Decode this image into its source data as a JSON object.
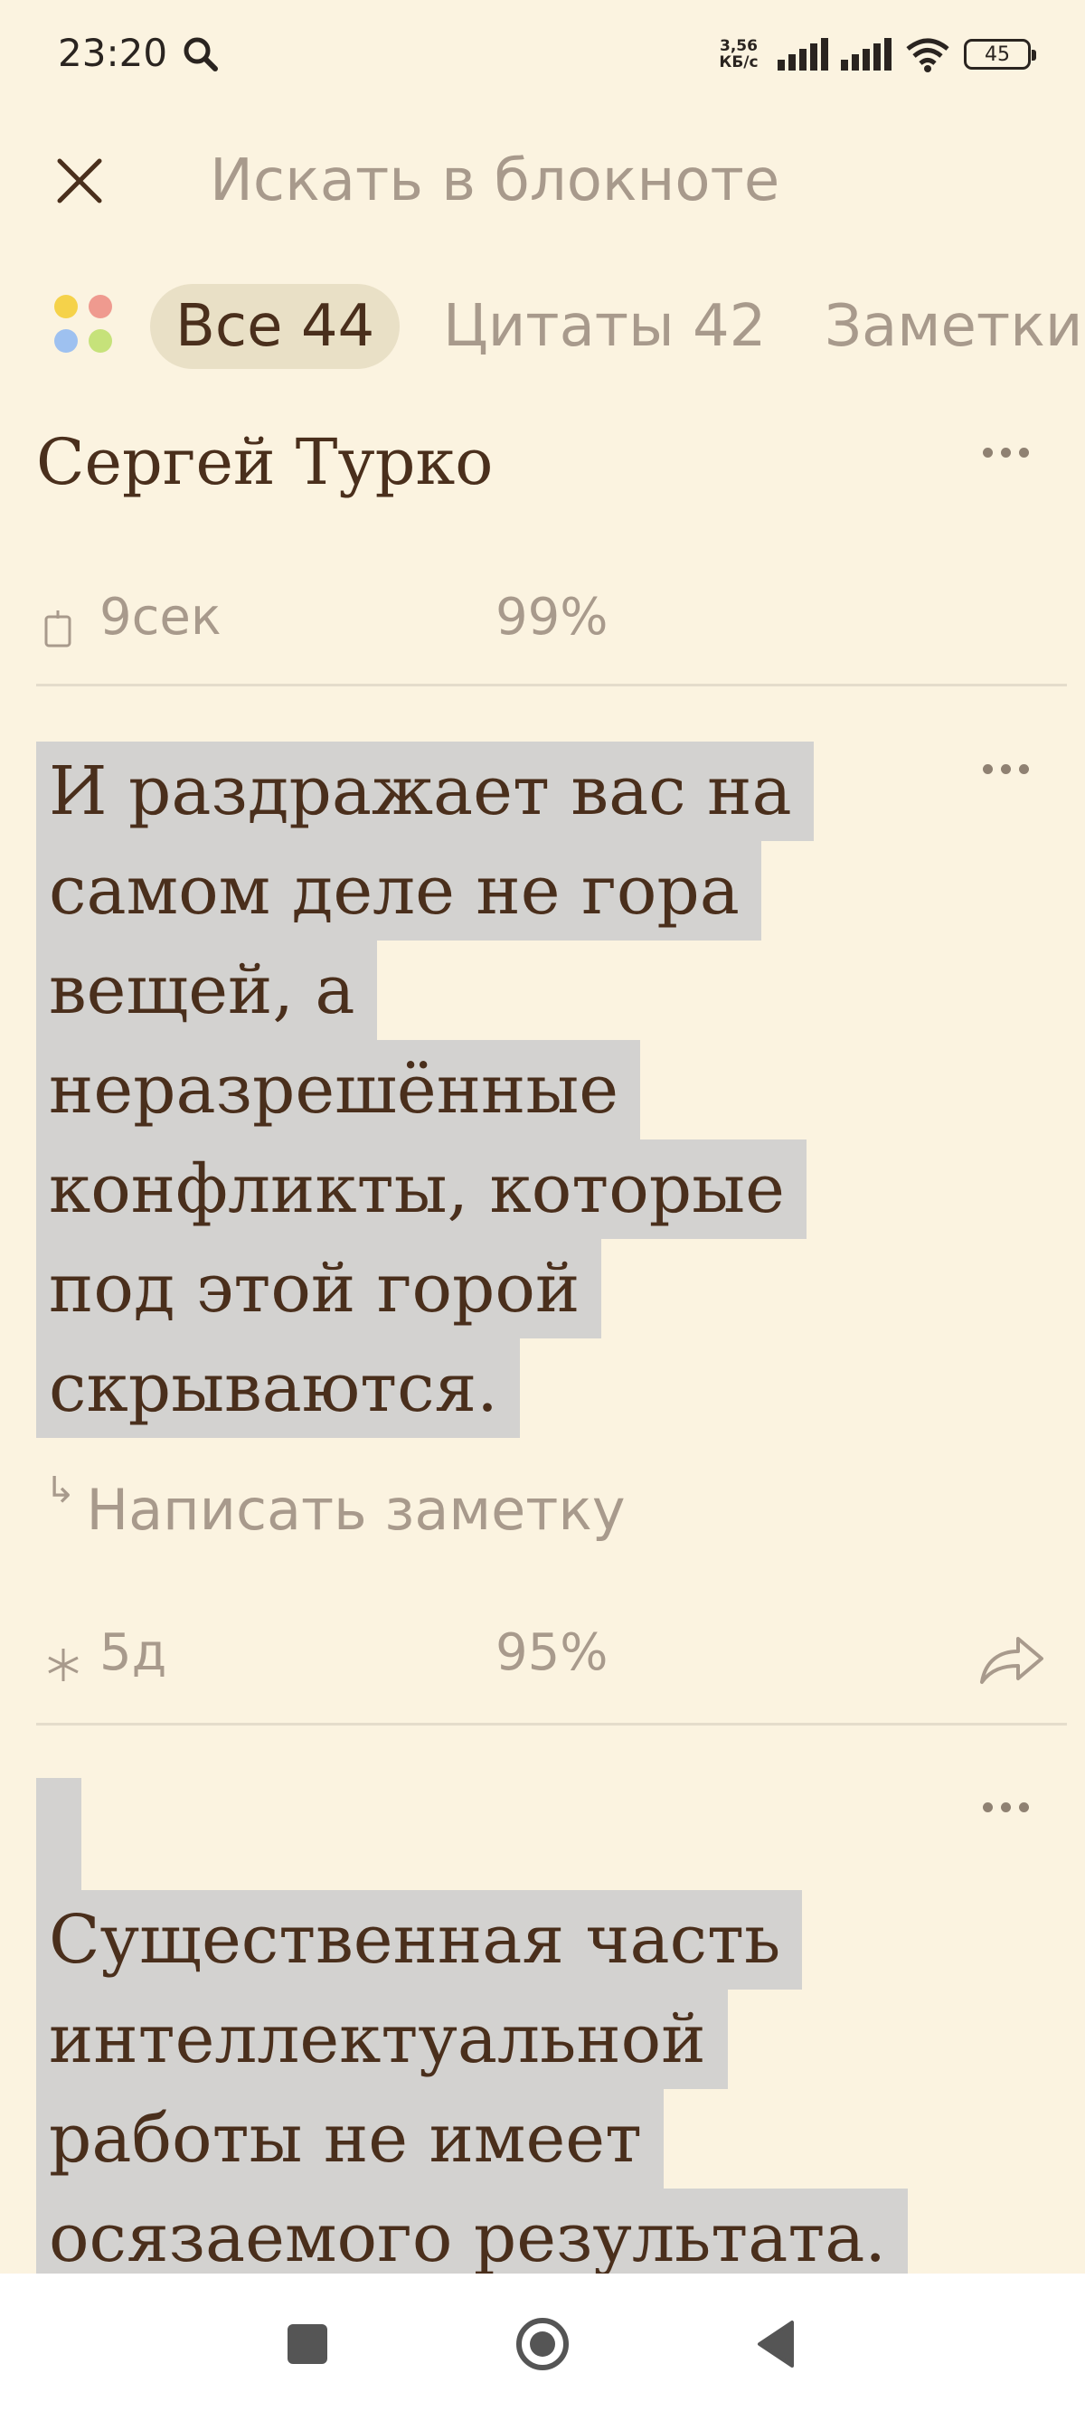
{
  "status_bar": {
    "time": "23:20",
    "net_speed_value": "3,56",
    "net_speed_unit": "КБ/с",
    "battery": "45",
    "icons": [
      "search-icon",
      "signal-icon",
      "signal-icon",
      "wifi-icon",
      "battery-icon"
    ]
  },
  "search": {
    "placeholder": "Искать в блокноте"
  },
  "filters": {
    "items": [
      {
        "label": "Все 44",
        "active": true
      },
      {
        "label": "Цитаты 42",
        "active": false
      },
      {
        "label": "Заметки",
        "active": false
      }
    ],
    "dot_colors": [
      "#f5d24a",
      "#ef9a8f",
      "#9ec1f0",
      "#c6e27a"
    ]
  },
  "book": {
    "title": "Сергей Турко",
    "read_time": "9сек",
    "progress": "99%"
  },
  "quotes": [
    {
      "lines": [
        "И раздражает вас на",
        "самом деле не гора",
        "вещей, а",
        "неразрешённые",
        "конфликты, которые",
        "под этой горой",
        "скрываются."
      ],
      "note_label": "Написать заметку",
      "age": "5д",
      "progress": "95%"
    },
    {
      "lines": [
        "Существенная часть",
        "интеллектуальной",
        "работы не имеет",
        "осязаемого результата."
      ]
    }
  ],
  "colors": {
    "background": "#fbf3e0",
    "text": "#4a2f1c",
    "muted": "#a89a8c",
    "highlight": "#d3d2d0",
    "chip_active": "#e9e0c6"
  }
}
